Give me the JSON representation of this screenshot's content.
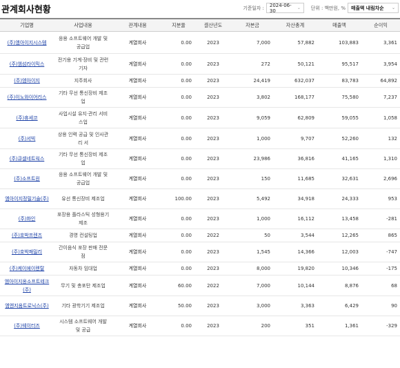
{
  "header": {
    "title": "관계회사현황",
    "date_label": "기준일자 :",
    "date_value": "2024-06-30",
    "unit_label": "단위 : 백만원, %",
    "sort_value": "매출액 내림차순"
  },
  "table": {
    "columns": [
      "기업명",
      "사업내용",
      "관계내용",
      "지분율",
      "결산년도",
      "자본금",
      "자산총계",
      "매출액",
      "순이익"
    ],
    "rows": [
      [
        "(주)엠아이지시스템",
        "응용 소프트웨어 개발 및 공급업",
        "계열회사",
        "0.00",
        "2023",
        "7,000",
        "57,882",
        "103,883",
        "3,361"
      ],
      [
        "(주)엠섬라이믹스",
        "전기용 기계·장비 및 관련 기자",
        "계열회사",
        "0.00",
        "2023",
        "272",
        "50,121",
        "95,517",
        "3,954"
      ],
      [
        "(주)엠아이지",
        "지주회사",
        "계열회사",
        "0.00",
        "2023",
        "24,419",
        "632,037",
        "83,783",
        "64,892"
      ],
      [
        "(주)이노와이어리스",
        "기타 무선 통신장비 제조업",
        "계열회사",
        "0.00",
        "2023",
        "3,802",
        "168,177",
        "75,580",
        "7,237"
      ],
      [
        "(주)휴세코",
        "사업시설 유지·관리 서비스업",
        "계열회사",
        "0.00",
        "2023",
        "9,059",
        "62,809",
        "59,055",
        "1,058"
      ],
      [
        "(주)서빅",
        "상용 인력 공급 및 인사관리 서",
        "계열회사",
        "0.00",
        "2023",
        "1,000",
        "9,707",
        "52,260",
        "132"
      ],
      [
        "(주)큐셀네트웍스",
        "기타 무선 통신장비 제조업",
        "계열회사",
        "0.00",
        "2023",
        "23,986",
        "36,816",
        "41,165",
        "1,310"
      ],
      [
        "(주)소프트원",
        "응용 소프트웨어 개발 및 공급업",
        "계열회사",
        "0.00",
        "2023",
        "150",
        "11,685",
        "32,631",
        "2,696"
      ],
      [
        "엠아이지정밀기술(주)",
        "유선 통신장비 제조업",
        "계열회사",
        "100.00",
        "2023",
        "5,492",
        "34,918",
        "24,333",
        "953"
      ],
      [
        "(주)화인",
        "포장용 플라스틱 성형용기 제조",
        "계열회사",
        "0.00",
        "2023",
        "1,000",
        "16,112",
        "13,458",
        "-281"
      ],
      [
        "(주)호박프렌즈",
        "경영 컨설팅업",
        "계열회사",
        "0.00",
        "2022",
        "50",
        "3,544",
        "12,265",
        "865"
      ],
      [
        "(주)호박패밀리",
        "간이음식 포장 판매 전문점",
        "계열회사",
        "0.00",
        "2023",
        "1,545",
        "14,366",
        "12,003",
        "-747"
      ],
      [
        "(주)케이에이렌탈",
        "자동차 임대업",
        "계열회사",
        "0.00",
        "2023",
        "8,000",
        "19,820",
        "10,346",
        "-175"
      ],
      [
        "엠아이지옹소프트테크(주)",
        "무기 및 총포탄 제조업",
        "계열회사",
        "60.00",
        "2022",
        "7,000",
        "10,144",
        "8,876",
        "68"
      ],
      [
        "엠엔지옴트로닉스(주)",
        "기타 광학기기 제조업",
        "계열회사",
        "50.00",
        "2023",
        "3,000",
        "3,363",
        "6,429",
        "90"
      ],
      [
        "(주)웨이터즈",
        "시스템 소프트웨어 개발 및 공급",
        "계열회사",
        "0.00",
        "2023",
        "200",
        "351",
        "1,361",
        "-329"
      ]
    ]
  }
}
